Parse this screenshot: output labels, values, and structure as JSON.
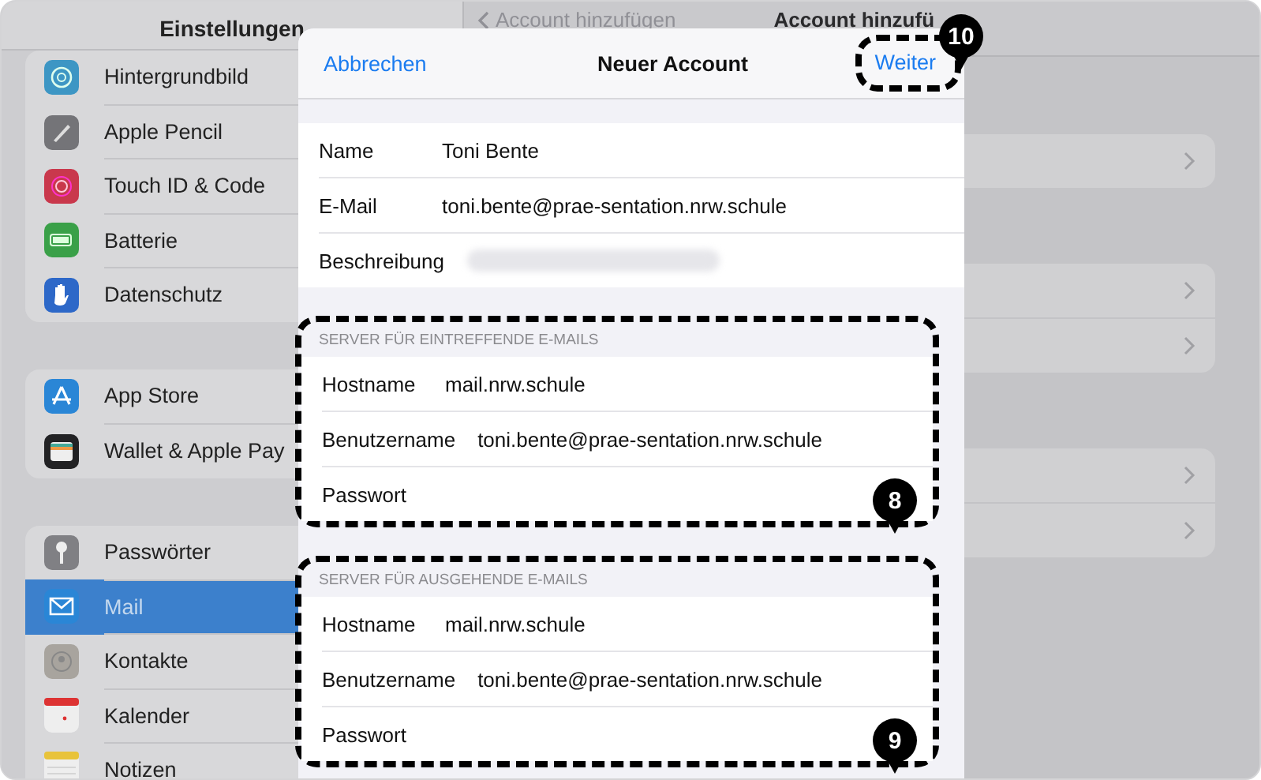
{
  "sidebar": {
    "title": "Einstellungen",
    "groups": [
      {
        "items": [
          {
            "label": "Hintergrundbild",
            "selected": false
          },
          {
            "label": "Apple Pencil",
            "selected": false
          },
          {
            "label": "Touch ID & Code",
            "selected": false
          },
          {
            "label": "Batterie",
            "selected": false
          },
          {
            "label": "Datenschutz",
            "selected": false
          }
        ]
      },
      {
        "items": [
          {
            "label": "App Store",
            "selected": false
          },
          {
            "label": "Wallet & Apple Pay",
            "selected": false
          }
        ]
      },
      {
        "items": [
          {
            "label": "Passwörter",
            "selected": false
          },
          {
            "label": "Mail",
            "selected": true
          },
          {
            "label": "Kontakte",
            "selected": false
          },
          {
            "label": "Kalender",
            "selected": false
          },
          {
            "label": "Notizen",
            "selected": false
          }
        ]
      }
    ]
  },
  "detail": {
    "back": "Account hinzufügen",
    "title": "Account hinzufü"
  },
  "modal": {
    "cancel": "Abbrechen",
    "title": "Neuer Account",
    "next": "Weiter",
    "next_callout": "10",
    "fields": [
      {
        "label": "Name",
        "value": "Toni Bente"
      },
      {
        "label": "E-Mail",
        "value": "toni.bente@prae-sentation.nrw.schule"
      },
      {
        "label": "Beschreibung",
        "kind": "blurred"
      }
    ],
    "sections": [
      {
        "header": "SERVER FÜR EINTREFFENDE E-MAILS",
        "callout": "8",
        "fields": [
          {
            "label": "Hostname",
            "value": "mail.nrw.schule"
          },
          {
            "label": "Benutzername",
            "value": "toni.bente@prae-sentation.nrw.schule"
          },
          {
            "label": "Passwort"
          }
        ]
      },
      {
        "header": "SERVER FÜR AUSGEHENDE E-MAILS",
        "callout": "9",
        "fields": [
          {
            "label": "Hostname",
            "value": "mail.nrw.schule"
          },
          {
            "label": "Benutzername",
            "value": "toni.bente@prae-sentation.nrw.schule"
          },
          {
            "label": "Passwort"
          }
        ]
      }
    ]
  }
}
